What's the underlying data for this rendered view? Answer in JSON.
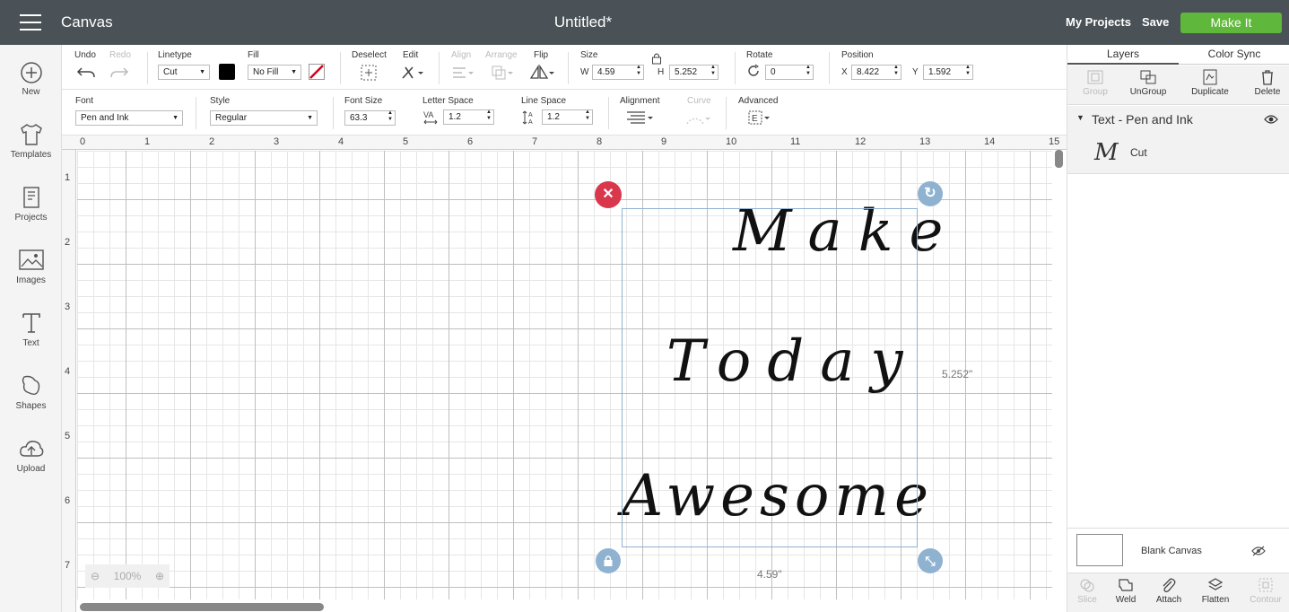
{
  "header": {
    "app_title": "Canvas",
    "doc_title": "Untitled*",
    "my_projects": "My Projects",
    "save": "Save",
    "make_it": "Make It"
  },
  "sidebar": {
    "items": [
      {
        "label": "New",
        "icon": "plus-circle-icon"
      },
      {
        "label": "Templates",
        "icon": "tshirt-icon"
      },
      {
        "label": "Projects",
        "icon": "projects-icon"
      },
      {
        "label": "Images",
        "icon": "image-icon"
      },
      {
        "label": "Text",
        "icon": "text-icon"
      },
      {
        "label": "Shapes",
        "icon": "shapes-icon"
      },
      {
        "label": "Upload",
        "icon": "upload-icon"
      }
    ]
  },
  "toolbar1": {
    "undo": "Undo",
    "redo": "Redo",
    "linetype_label": "Linetype",
    "linetype_value": "Cut",
    "fill_label": "Fill",
    "fill_value": "No Fill",
    "deselect": "Deselect",
    "edit": "Edit",
    "align": "Align",
    "arrange": "Arrange",
    "flip": "Flip",
    "size_label": "Size",
    "w_label": "W",
    "w_value": "4.59",
    "h_label": "H",
    "h_value": "5.252",
    "rotate_label": "Rotate",
    "rotate_value": "0",
    "position_label": "Position",
    "x_label": "X",
    "x_value": "8.422",
    "y_label": "Y",
    "y_value": "1.592"
  },
  "toolbar2": {
    "font_label": "Font",
    "font_value": "Pen and Ink",
    "style_label": "Style",
    "style_value": "Regular",
    "font_size_label": "Font Size",
    "font_size_value": "63.3",
    "letter_space_label": "Letter Space",
    "letter_space_value": "1.2",
    "line_space_label": "Line Space",
    "line_space_value": "1.2",
    "alignment_label": "Alignment",
    "curve_label": "Curve",
    "advanced_label": "Advanced"
  },
  "canvas": {
    "ruler_x": [
      "0",
      "1",
      "2",
      "3",
      "4",
      "5",
      "6",
      "7",
      "8",
      "9",
      "10",
      "11",
      "12",
      "13",
      "14",
      "15"
    ],
    "ruler_y": [
      "1",
      "2",
      "3",
      "4",
      "5",
      "6",
      "7"
    ],
    "lines": [
      "Make",
      "Today",
      "Awesome"
    ],
    "height_dim": "5.252\"",
    "width_dim": "4.59\"",
    "zoom": "100%"
  },
  "right_panel": {
    "tab_layers": "Layers",
    "tab_color_sync": "Color Sync",
    "tools": [
      "Group",
      "UnGroup",
      "Duplicate",
      "Delete"
    ],
    "layer_group": "Text - Pen and Ink",
    "layer_item": "Cut",
    "layer_glyph": "M",
    "blank_canvas": "Blank Canvas",
    "bottom_tools": [
      "Slice",
      "Weld",
      "Attach",
      "Flatten",
      "Contour"
    ]
  },
  "colors": {
    "topbar": "#4a5257",
    "make_it": "#5fb83b",
    "delete_handle": "#d9374b",
    "handle": "#8fb2d1"
  }
}
